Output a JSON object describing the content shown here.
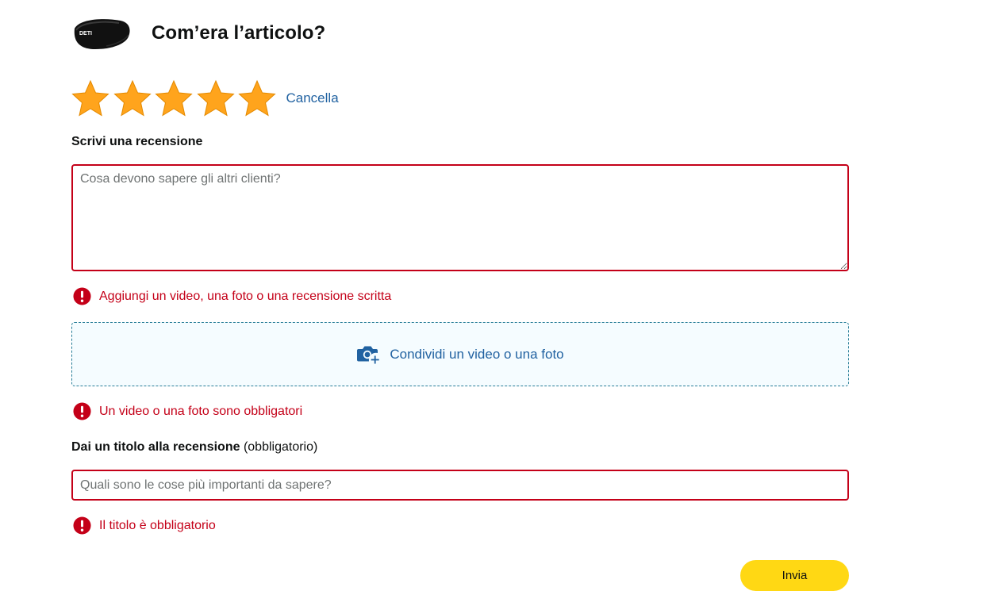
{
  "header": {
    "title": "Com’era l’articolo?",
    "product_image": "sleep-mask-thumbnail",
    "product_brand_mark": "DETI"
  },
  "rating": {
    "value": 5,
    "max": 5,
    "star_color": "#ffa41c",
    "clear_label": "Cancella"
  },
  "review": {
    "label": "Scrivi una recensione",
    "value": "",
    "placeholder": "Cosa devono sapere gli altri clienti?",
    "error": "Aggiungi un video, una foto o una recensione scritta"
  },
  "media": {
    "upload_label": "Condividi un video o una foto",
    "icon": "camera-plus-icon",
    "error": "Un video o una foto sono obbligatori"
  },
  "title_field": {
    "label": "Dai un titolo alla recensione",
    "label_suffix": "(obbligatorio)",
    "value": "",
    "placeholder": "Quali sono le cose più importanti da sapere?",
    "error": "Il titolo è obbligatorio"
  },
  "submit": {
    "label": "Invia"
  },
  "colors": {
    "error": "#c40018",
    "link": "#2162a1",
    "button": "#ffd814",
    "upload_bg": "#f5fcff"
  }
}
